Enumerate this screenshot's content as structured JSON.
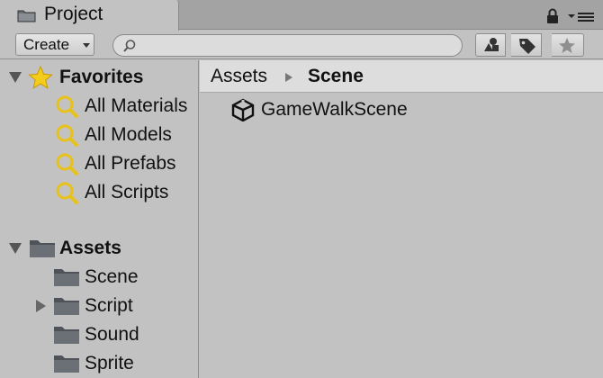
{
  "window": {
    "tab_title": "Project",
    "icons": {
      "tab": "folder-icon",
      "lock": "lock-icon",
      "menu": "window-menu-icon"
    }
  },
  "toolbar": {
    "create_label": "Create",
    "search_placeholder": "",
    "search_value": "",
    "buttons": [
      {
        "name": "filter-by-type",
        "icon": "shapes-icon"
      },
      {
        "name": "filter-by-label",
        "icon": "tag-icon"
      },
      {
        "name": "save-search",
        "icon": "star-icon"
      }
    ]
  },
  "sidebar": {
    "favorites": {
      "label": "Favorites",
      "icon": "star-icon",
      "items": [
        {
          "label": "All Materials",
          "icon": "search-icon"
        },
        {
          "label": "All Models",
          "icon": "search-icon"
        },
        {
          "label": "All Prefabs",
          "icon": "search-icon"
        },
        {
          "label": "All Scripts",
          "icon": "search-icon"
        }
      ]
    },
    "assets": {
      "label": "Assets",
      "icon": "folder-icon",
      "items": [
        {
          "label": "Scene",
          "icon": "folder-icon",
          "expandable": false
        },
        {
          "label": "Script",
          "icon": "folder-icon",
          "expandable": true
        },
        {
          "label": "Sound",
          "icon": "folder-icon",
          "expandable": false
        },
        {
          "label": "Sprite",
          "icon": "folder-icon",
          "expandable": false
        }
      ]
    }
  },
  "main": {
    "breadcrumb": [
      "Assets",
      "Scene"
    ],
    "items": [
      {
        "label": "GameWalkScene",
        "icon": "unity-scene-icon"
      }
    ]
  },
  "colors": {
    "panel_bg": "#c2c2c2",
    "breadcrumb_bg": "#dddddd",
    "favorite_star": "#f4cc1c",
    "search_lens": "#e8c21a",
    "folder": "#555a60"
  }
}
